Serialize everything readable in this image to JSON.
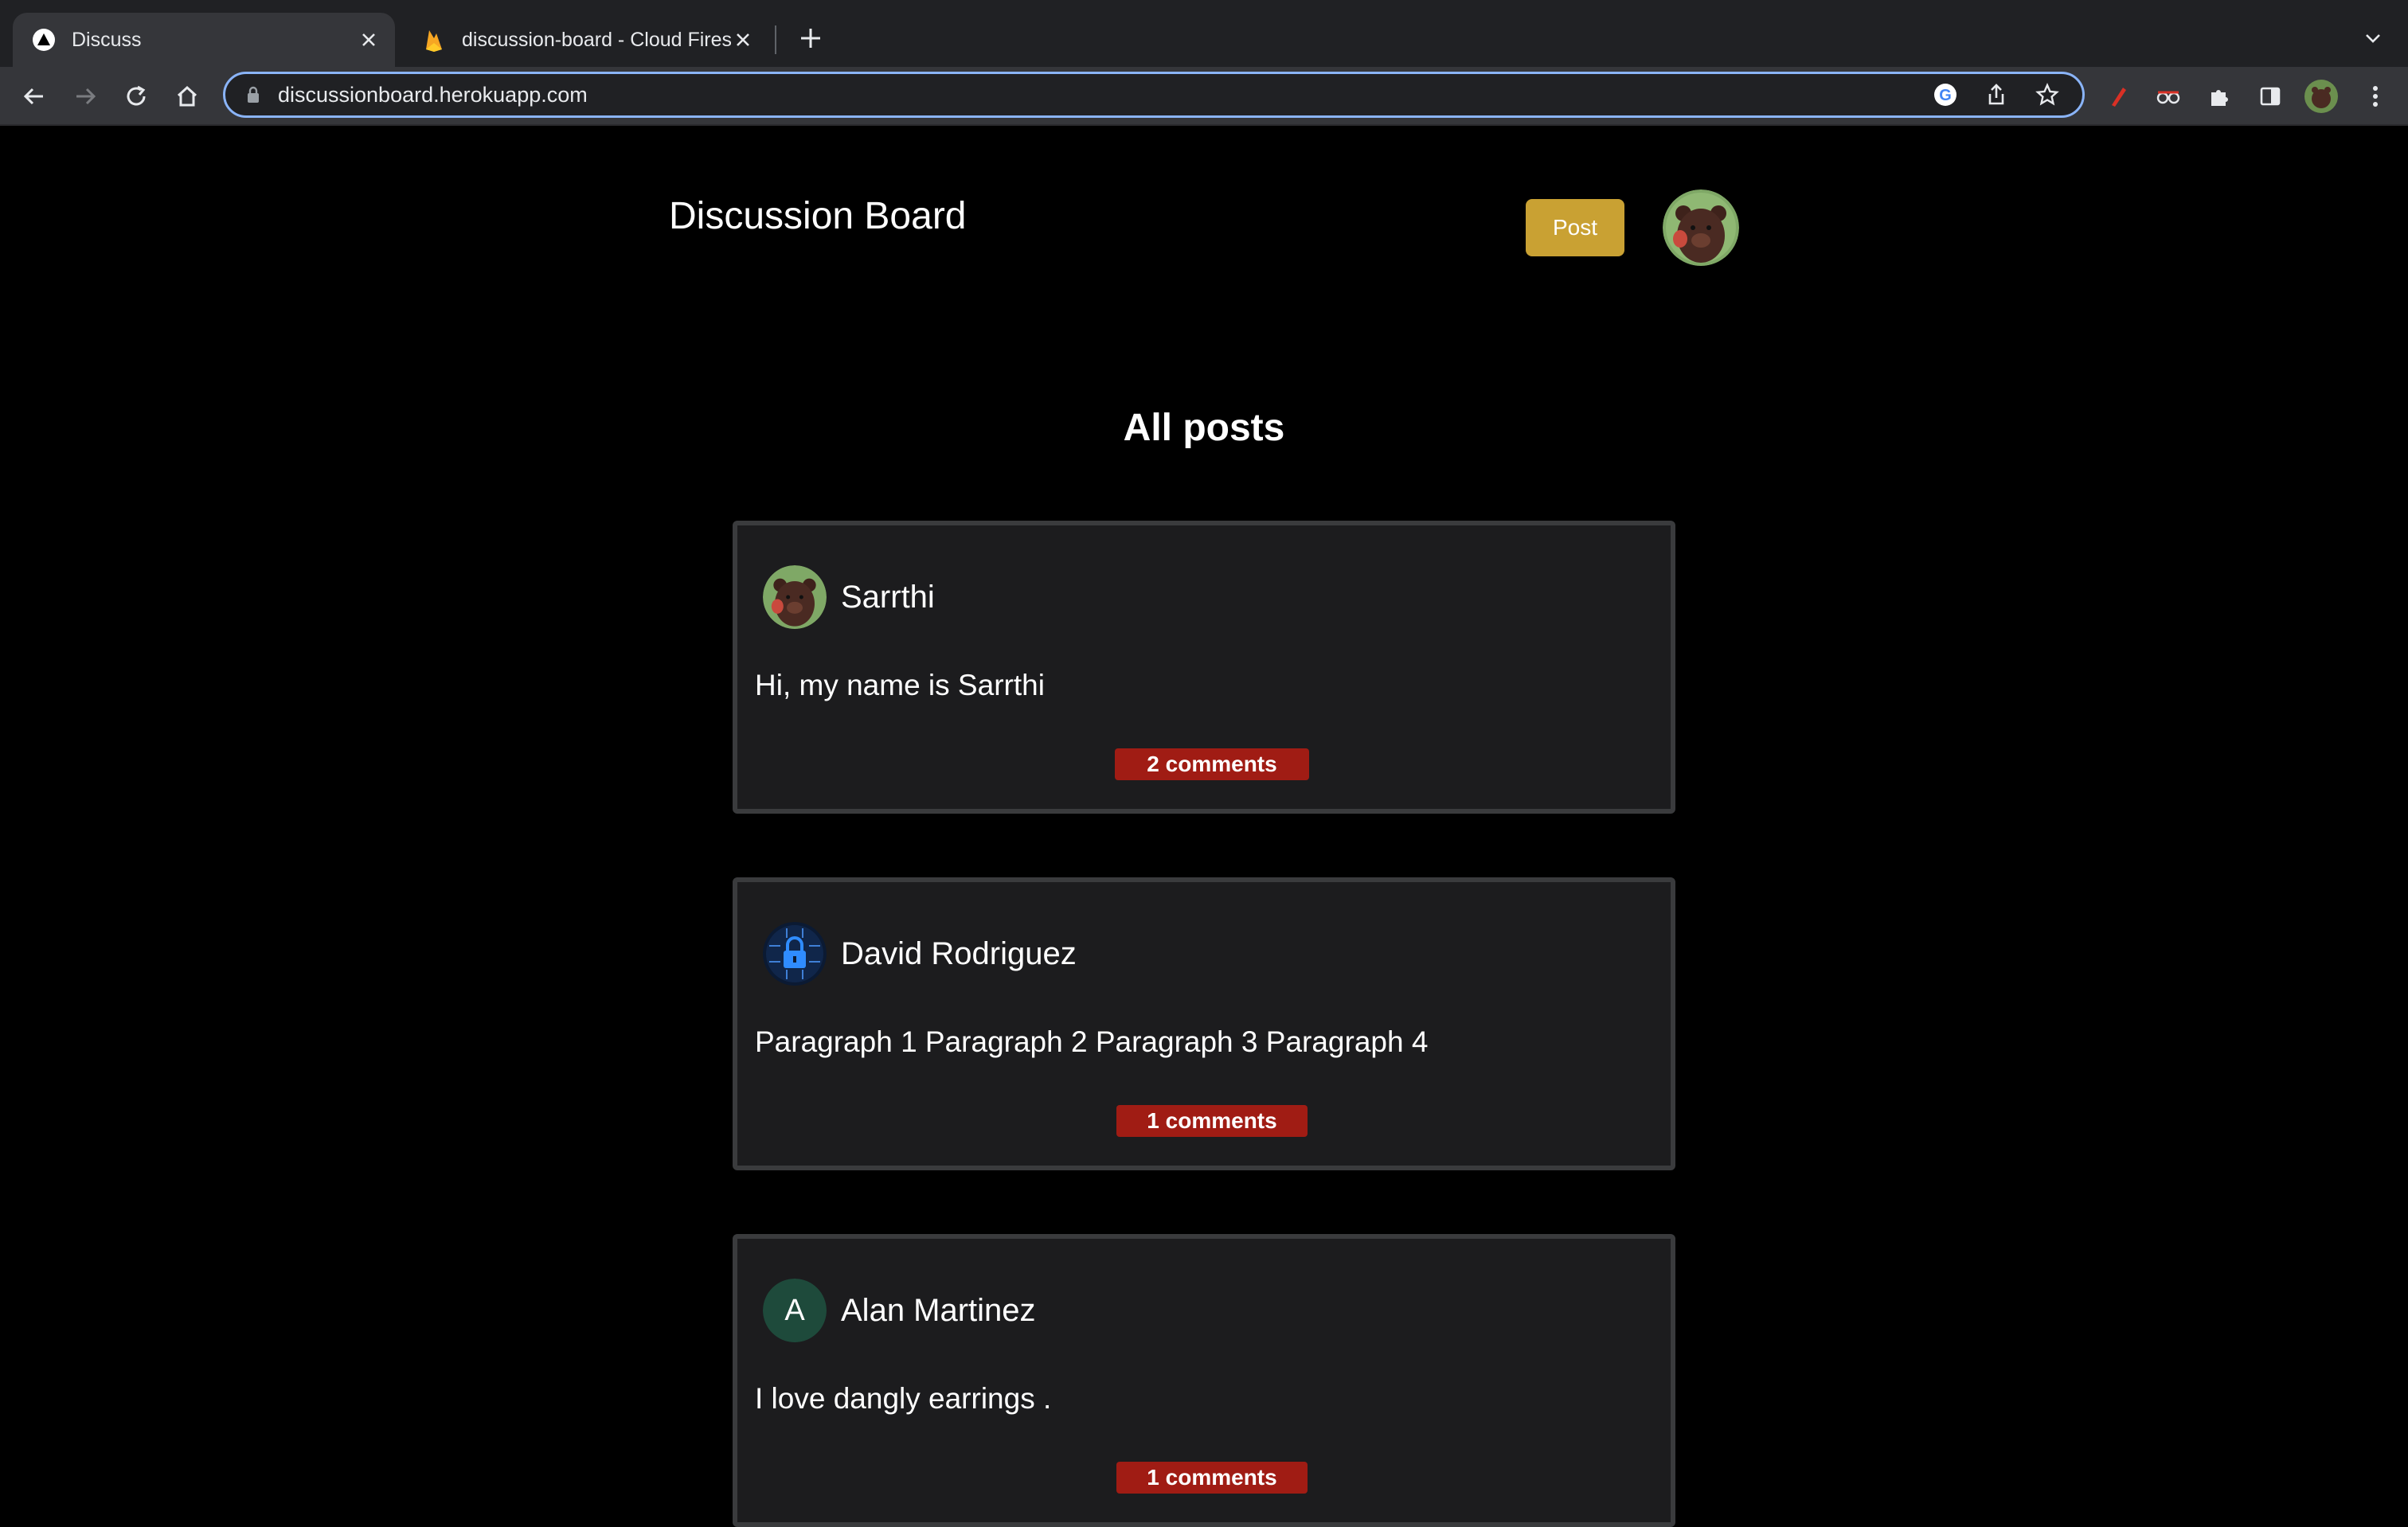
{
  "browser": {
    "tabs": [
      {
        "title": "Discuss",
        "active": true,
        "icon": "triangle-logo-icon"
      },
      {
        "title": "discussion-board - Cloud Fires",
        "active": false,
        "icon": "firebase-flame-icon"
      }
    ],
    "address": "discussionboard.herokuapp.com"
  },
  "header": {
    "title": "Discussion Board",
    "post_label": "Post"
  },
  "main": {
    "section_title": "All posts",
    "posts": [
      {
        "author": "Sarrthi",
        "avatar": "bear-avatar",
        "body": "Hi, my name is Sarrthi",
        "comments": "2 comments"
      },
      {
        "author": "David Rodriguez",
        "avatar": "lock-avatar",
        "body": "Paragraph 1 Paragraph 2 Paragraph 3 Paragraph 4",
        "comments": "1 comments"
      },
      {
        "author": "Alan Martinez",
        "avatar": "letter-avatar",
        "avatar_letter": "A",
        "body": "I love dangly earrings .",
        "comments": "1 comments"
      }
    ]
  },
  "colors": {
    "post_button": "#c9a133",
    "comments_badge": "#a01c14",
    "card_bg": "#1c1c1e",
    "letter_avatar_bg": "#1e4a3b"
  }
}
